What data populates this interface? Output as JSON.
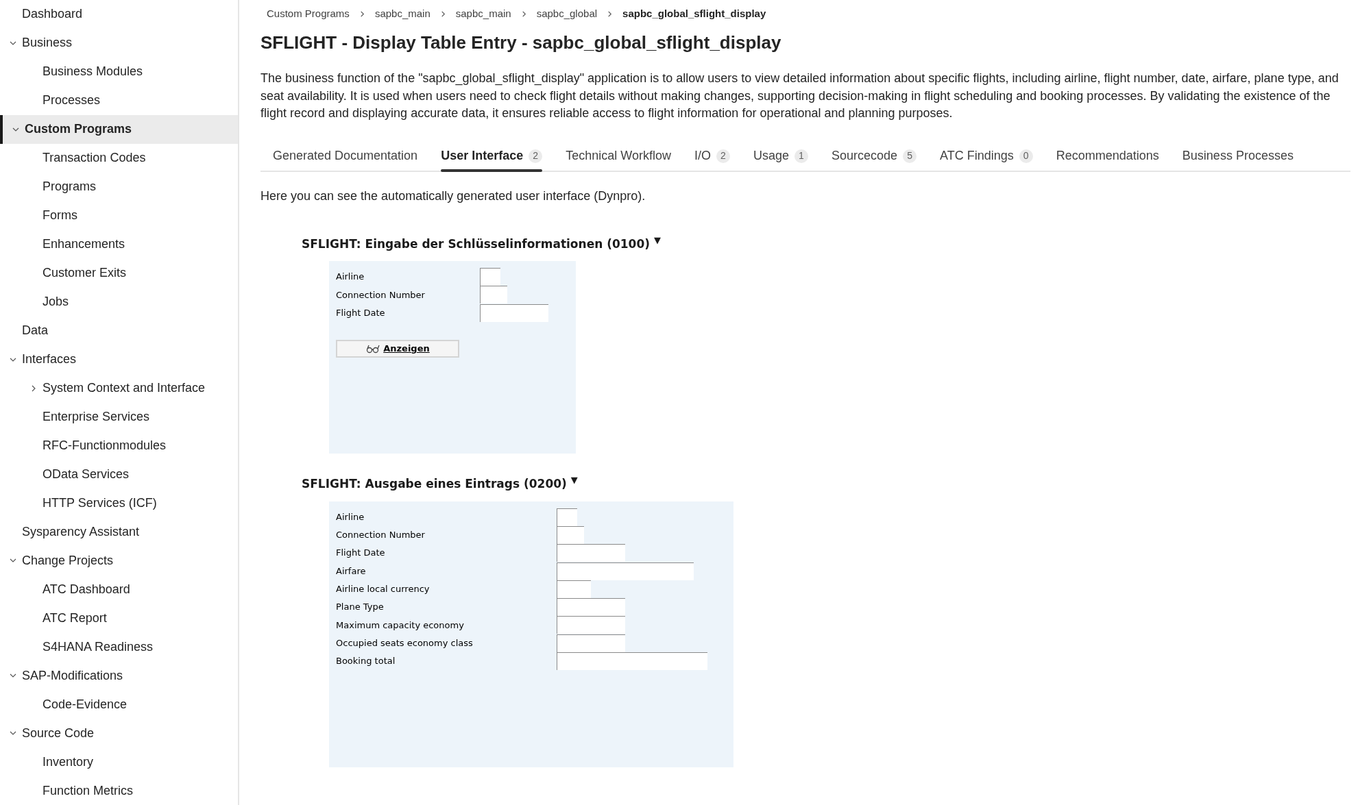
{
  "sidebar": {
    "items": [
      {
        "label": "Dashboard",
        "selected": false
      },
      {
        "label": "Business",
        "selected": false,
        "expanded": true,
        "children": [
          {
            "label": "Business Modules",
            "selected": false
          },
          {
            "label": "Processes",
            "selected": false
          }
        ]
      },
      {
        "label": "Custom Programs",
        "selected": true,
        "expanded": true,
        "children": [
          {
            "label": "Transaction Codes",
            "selected": false
          },
          {
            "label": "Programs",
            "selected": false
          },
          {
            "label": "Forms",
            "selected": false
          },
          {
            "label": "Enhancements",
            "selected": false
          },
          {
            "label": "Customer Exits",
            "selected": false
          },
          {
            "label": "Jobs",
            "selected": false
          }
        ]
      },
      {
        "label": "Data",
        "selected": false
      },
      {
        "label": "Interfaces",
        "selected": false,
        "expanded": true,
        "children": [
          {
            "label": "System Context and Interface",
            "selected": false,
            "expanded": false
          },
          {
            "label": "Enterprise Services",
            "selected": false
          },
          {
            "label": "RFC-Functionmodules",
            "selected": false
          },
          {
            "label": "OData Services",
            "selected": false
          },
          {
            "label": "HTTP Services (ICF)",
            "selected": false
          }
        ]
      },
      {
        "label": "Sysparency Assistant",
        "selected": false
      },
      {
        "label": "Change Projects",
        "selected": false,
        "expanded": true,
        "children": [
          {
            "label": "ATC Dashboard",
            "selected": false
          },
          {
            "label": "ATC Report",
            "selected": false
          },
          {
            "label": "S4HANA Readiness",
            "selected": false
          }
        ]
      },
      {
        "label": "SAP-Modifications",
        "selected": false,
        "expanded": true,
        "children": [
          {
            "label": "Code-Evidence",
            "selected": false
          }
        ]
      },
      {
        "label": "Source Code",
        "selected": false,
        "expanded": true,
        "children": [
          {
            "label": "Inventory",
            "selected": false
          },
          {
            "label": "Function Metrics",
            "selected": false
          }
        ]
      }
    ]
  },
  "breadcrumb": [
    "Custom Programs",
    "sapbc_main",
    "sapbc_main",
    "sapbc_global",
    "sapbc_global_sflight_display"
  ],
  "title": "SFLIGHT - Display Table Entry - sapbc_global_sflight_display",
  "description": "The business function of the \"sapbc_global_sflight_display\" application is to allow users to view detailed information about specific flights, including airline, flight number, date, airfare, plane type, and seat availability. It is used when users need to check flight details without making changes, supporting decision-making in flight scheduling and booking processes. By validating the existence of the flight record and displaying accurate data, it ensures reliable access to flight information for operational and planning purposes.",
  "tabs": [
    {
      "label": "Generated Documentation",
      "selected": false
    },
    {
      "label": "User Interface",
      "count": "2",
      "selected": true
    },
    {
      "label": "Technical Workflow",
      "selected": false
    },
    {
      "label": "I/O",
      "count": "2",
      "selected": false
    },
    {
      "label": "Usage",
      "count": "1",
      "selected": false
    },
    {
      "label": "Sourcecode",
      "count": "5",
      "selected": false
    },
    {
      "label": "ATC Findings",
      "count": "0",
      "selected": false
    },
    {
      "label": "Recommendations",
      "selected": false
    },
    {
      "label": "Business Processes",
      "selected": false
    }
  ],
  "intro": "Here you can see the automatically generated user interface (Dynpro).",
  "screens": [
    {
      "title": "SFLIGHT: Eingabe der Schlüsselinformationen (0100)",
      "toggle": "▼",
      "fields": [
        {
          "label": "Airline"
        },
        {
          "label": "Connection Number"
        },
        {
          "label": "Flight Date"
        }
      ],
      "button": {
        "label": "Anzeigen"
      }
    },
    {
      "title": "SFLIGHT: Ausgabe eines Eintrags (0200)",
      "toggle": "▼",
      "fields": [
        {
          "label": "Airline"
        },
        {
          "label": "Connection Number"
        },
        {
          "label": "Flight Date"
        },
        {
          "label": "Airfare"
        },
        {
          "label": "Airline local currency"
        },
        {
          "label": "Plane Type"
        },
        {
          "label": "Maximum capacity economy"
        },
        {
          "label": "Occupied seats economy class"
        },
        {
          "label": "Booking total"
        }
      ]
    }
  ]
}
